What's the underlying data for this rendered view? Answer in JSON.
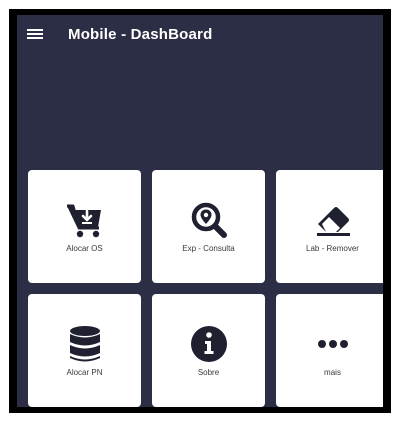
{
  "app": {
    "title": "Mobile - DashBoard"
  },
  "tiles": [
    {
      "label": "Alocar OS",
      "icon": "cart-download-icon"
    },
    {
      "label": "Exp - Consulta",
      "icon": "search-location-icon"
    },
    {
      "label": "Lab - Remover",
      "icon": "eraser-icon"
    },
    {
      "label": "Alocar PN",
      "icon": "database-icon"
    },
    {
      "label": "Sobre",
      "icon": "info-icon"
    },
    {
      "label": "mais",
      "icon": "more-dots-icon"
    }
  ],
  "colors": {
    "background": "#2c2e45",
    "tile": "#ffffff",
    "icon": "#1f2030"
  }
}
